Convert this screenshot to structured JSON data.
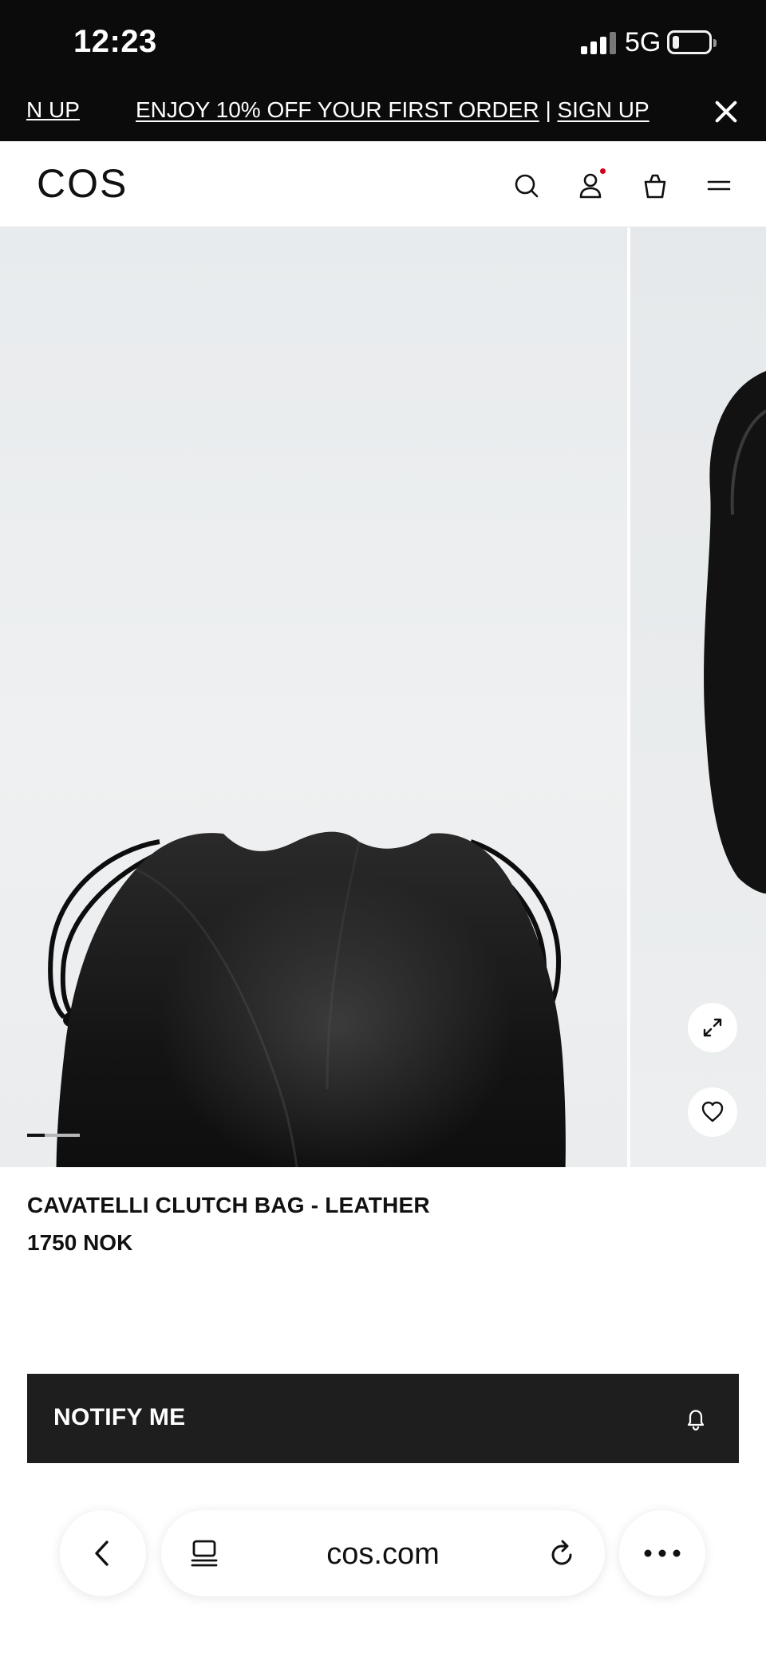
{
  "status_bar": {
    "time": "12:23",
    "network": "5G"
  },
  "promo": {
    "previous_fragment": "N UP",
    "offer_text": "ENJOY 10% OFF YOUR FIRST ORDER",
    "separator": "|",
    "cta": "SIGN UP"
  },
  "header": {
    "logo": "COS",
    "icons": [
      "search-icon",
      "account-icon",
      "bag-icon",
      "menu-icon"
    ],
    "account_indicator_color": "#d0021b"
  },
  "gallery": {
    "current_image": 1,
    "progress_fraction": 0.33
  },
  "product": {
    "name": "CAVATELLI CLUTCH BAG - LEATHER",
    "price": "1750 NOK"
  },
  "notify_button": {
    "label": "NOTIFY ME"
  },
  "browser": {
    "url": "cos.com"
  },
  "colors": {
    "dark": "#0b0b0c",
    "button": "#1e1e1e",
    "gallery_bg": "#e9ecee"
  }
}
